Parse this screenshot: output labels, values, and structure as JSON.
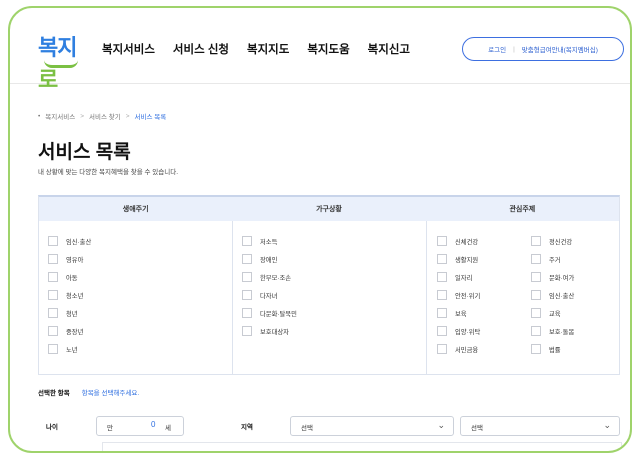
{
  "header": {
    "logo": {
      "part1": "복지",
      "part2": "로"
    },
    "nav": [
      "복지서비스",
      "서비스 신청",
      "복지지도",
      "복지도움",
      "복지신고"
    ],
    "login": "로그인",
    "separator": "|",
    "info": "맞춤형급여안내(복지멤버십)"
  },
  "breadcrumb": {
    "bullet": "•",
    "items": [
      "복지서비스",
      "서비스 찾기",
      "서비스 목록"
    ],
    "arrow": ">"
  },
  "page": {
    "title": "서비스 목록",
    "description": "내 상황에 맞는 다양한 복지혜택을 찾을 수 있습니다."
  },
  "filter": {
    "headers": [
      "생애주기",
      "가구상황",
      "관심주제"
    ],
    "life_cycle": [
      "임신·출산",
      "영유아",
      "아동",
      "청소년",
      "청년",
      "중장년",
      "노년"
    ],
    "household": [
      "저소득",
      "장애인",
      "한부모·조손",
      "다자녀",
      "다문화·탈북민",
      "보호대상자"
    ],
    "interest_left": [
      "신체건강",
      "생활지원",
      "일자리",
      "안전·위기",
      "보육",
      "입양·위탁",
      "서민금융"
    ],
    "interest_right": [
      "정신건강",
      "주거",
      "문화·여가",
      "임신·출산",
      "교육",
      "보호·돌봄",
      "법률"
    ]
  },
  "selection": {
    "label": "선택한 항목",
    "hint": "항목을 선택해주세요."
  },
  "age": {
    "label": "나이",
    "prefix": "만",
    "value": "0",
    "unit": "세"
  },
  "region": {
    "label": "지역",
    "select1": "선택",
    "select2": "선택",
    "chevron": "⌄"
  },
  "colors": {
    "accent": "#2f6fe0",
    "frame": "#9fd36b",
    "header_bg": "#eaf0fb"
  }
}
